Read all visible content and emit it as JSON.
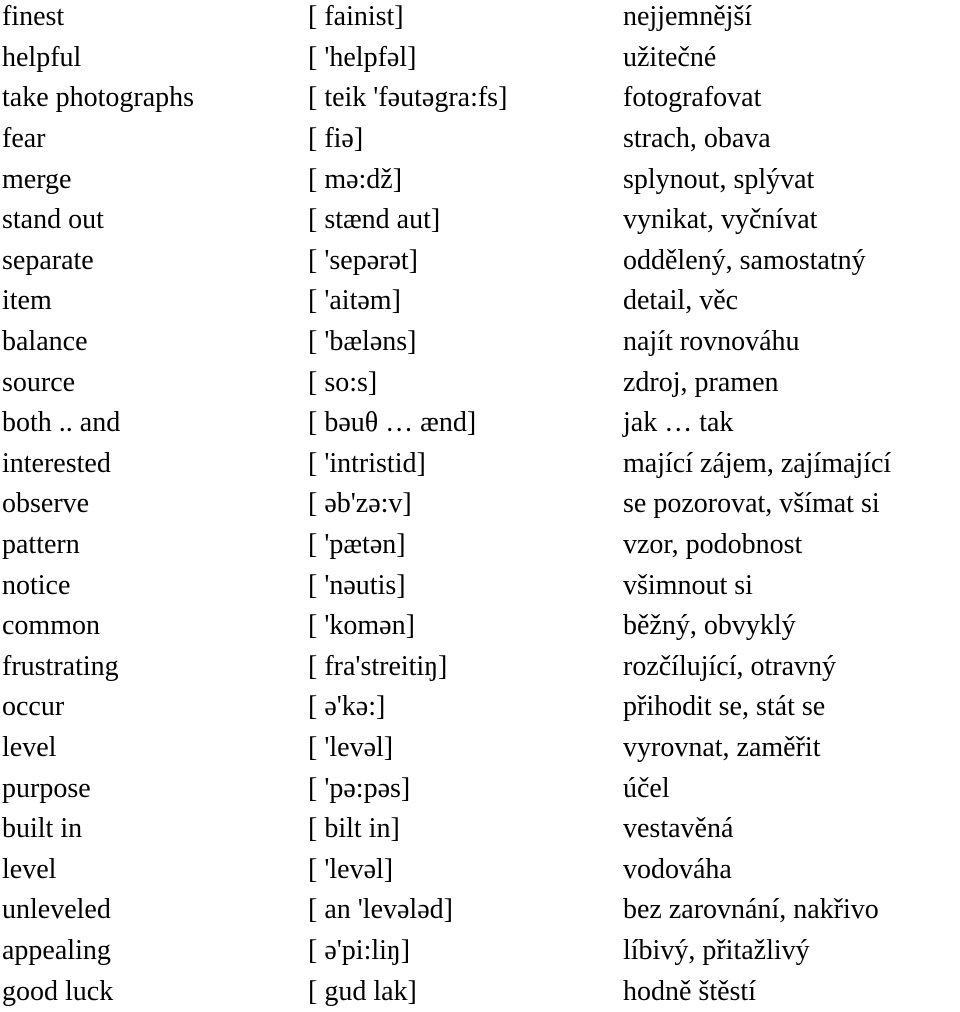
{
  "vocabulary": [
    {
      "english": "finest",
      "pronunciation": "[ fainist]",
      "czech": "nejjemnější"
    },
    {
      "english": "helpful",
      "pronunciation": "[ 'helpfəl]",
      "czech": "užitečné"
    },
    {
      "english": "take photographs",
      "pronunciation": "[ teik 'fəutəgra:fs]",
      "czech": "fotografovat"
    },
    {
      "english": "fear",
      "pronunciation": "[ fiə]",
      "czech": "strach, obava"
    },
    {
      "english": "merge",
      "pronunciation": "[ mə:dž]",
      "czech": "splynout, splývat"
    },
    {
      "english": "stand out",
      "pronunciation": "[ stænd aut]",
      "czech": "vynikat, vyčnívat"
    },
    {
      "english": "separate",
      "pronunciation": "[ 'sepərət]",
      "czech": "oddělený, samostatný"
    },
    {
      "english": "item",
      "pronunciation": "[ 'aitəm]",
      "czech": "detail, věc"
    },
    {
      "english": "balance",
      "pronunciation": "[ 'bæləns]",
      "czech": "najít rovnováhu"
    },
    {
      "english": "source",
      "pronunciation": "[ so:s]",
      "czech": "zdroj, pramen"
    },
    {
      "english": "both .. and",
      "pronunciation": "[ bəuθ … ænd]",
      "czech": "jak … tak"
    },
    {
      "english": "interested",
      "pronunciation": "[ 'intristid]",
      "czech": "mající zájem, zajímající"
    },
    {
      "english": "observe",
      "pronunciation": "[ əb'zə:v]",
      "czech": "se pozorovat, všímat si"
    },
    {
      "english": "pattern",
      "pronunciation": "[ 'pætən]",
      "czech": "vzor, podobnost"
    },
    {
      "english": "notice",
      "pronunciation": "[ 'nəutis]",
      "czech": "všimnout si"
    },
    {
      "english": "common",
      "pronunciation": "[ 'komən]",
      "czech": "běžný, obvyklý"
    },
    {
      "english": "frustrating",
      "pronunciation": "[ fra'streitiŋ]",
      "czech": "rozčílující, otravný"
    },
    {
      "english": "occur",
      "pronunciation": "[ ə'kə:]",
      "czech": "přihodit se, stát se"
    },
    {
      "english": "level",
      "pronunciation": "[ 'levəl]",
      "czech": "vyrovnat, zaměřit"
    },
    {
      "english": "purpose",
      "pronunciation": "[ 'pə:pəs]",
      "czech": "účel"
    },
    {
      "english": "built in",
      "pronunciation": "[ bilt in]",
      "czech": "vestavěná"
    },
    {
      "english": "level",
      "pronunciation": "[ 'levəl]",
      "czech": "vodováha"
    },
    {
      "english": "unleveled",
      "pronunciation": "[ an 'levələd]",
      "czech": "bez zarovnání, nakřivo"
    },
    {
      "english": "appealing",
      "pronunciation": "[ ə'pi:liŋ]",
      "czech": "líbivý, přitažlivý"
    },
    {
      "english": "good luck",
      "pronunciation": "[ gud lak]",
      "czech": "hodně štěstí"
    }
  ]
}
